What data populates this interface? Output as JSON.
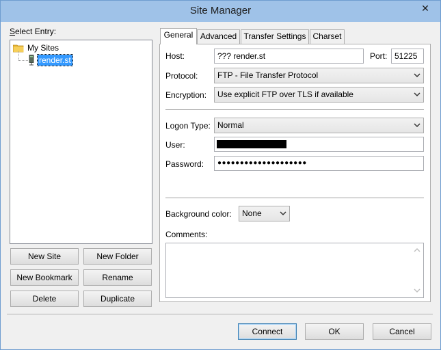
{
  "window": {
    "title": "Site Manager",
    "close_glyph": "✕"
  },
  "left": {
    "select_entry_label": "Select Entry:",
    "tree": {
      "root": "My Sites",
      "child": "render.st"
    },
    "buttons": {
      "new_site": "New Site",
      "new_folder": "New Folder",
      "new_bookmark": "New Bookmark",
      "rename": "Rename",
      "delete": "Delete",
      "duplicate": "Duplicate"
    }
  },
  "tabs": [
    "General",
    "Advanced",
    "Transfer Settings",
    "Charset"
  ],
  "general": {
    "host_label": "Host:",
    "host_value": "??? render.st",
    "port_label": "Port:",
    "port_value": "51225",
    "protocol_label": "Protocol:",
    "protocol_value": "FTP - File Transfer Protocol",
    "encryption_label": "Encryption:",
    "encryption_value": "Use explicit FTP over TLS if available",
    "logon_type_label": "Logon Type:",
    "logon_type_value": "Normal",
    "user_label": "User:",
    "password_label": "Password:",
    "password_value": "●●●●●●●●●●●●●●●●●●●●",
    "background_color_label": "Background color:",
    "background_color_value": "None",
    "comments_label": "Comments:"
  },
  "bottom": {
    "connect": "Connect",
    "ok": "OK",
    "cancel": "Cancel"
  },
  "colors": {
    "selection": "#3399ff",
    "titlebar": "#9fc2e8",
    "folder": "#e8b838"
  },
  "icons": [
    "close-icon",
    "folder-icon",
    "server-icon",
    "chevron-down-icon",
    "scroll-up-icon",
    "scroll-down-icon"
  ]
}
